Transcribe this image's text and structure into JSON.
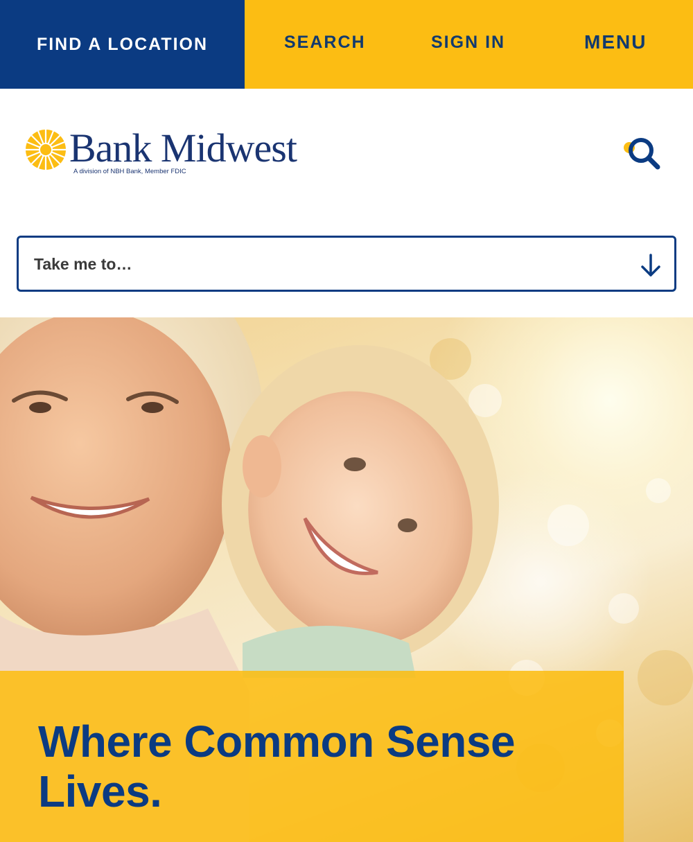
{
  "topbar": {
    "find_location": "FIND A LOCATION",
    "search": "SEARCH",
    "sign_in": "SIGN IN",
    "menu": "MENU"
  },
  "logo": {
    "wordmark": "Bank Midwest",
    "tagline": "A division of NBH Bank, Member FDIC"
  },
  "icons": {
    "search": "search-icon",
    "arrow": "arrow-down-icon",
    "sun": "sunburst-logo-icon"
  },
  "takeme": {
    "label": "Take me to…"
  },
  "hero": {
    "headline": "Where Common Sense Lives."
  },
  "colors": {
    "navy": "#0b3b82",
    "yellow": "#fcbd13",
    "text_dark": "#123a6e"
  }
}
